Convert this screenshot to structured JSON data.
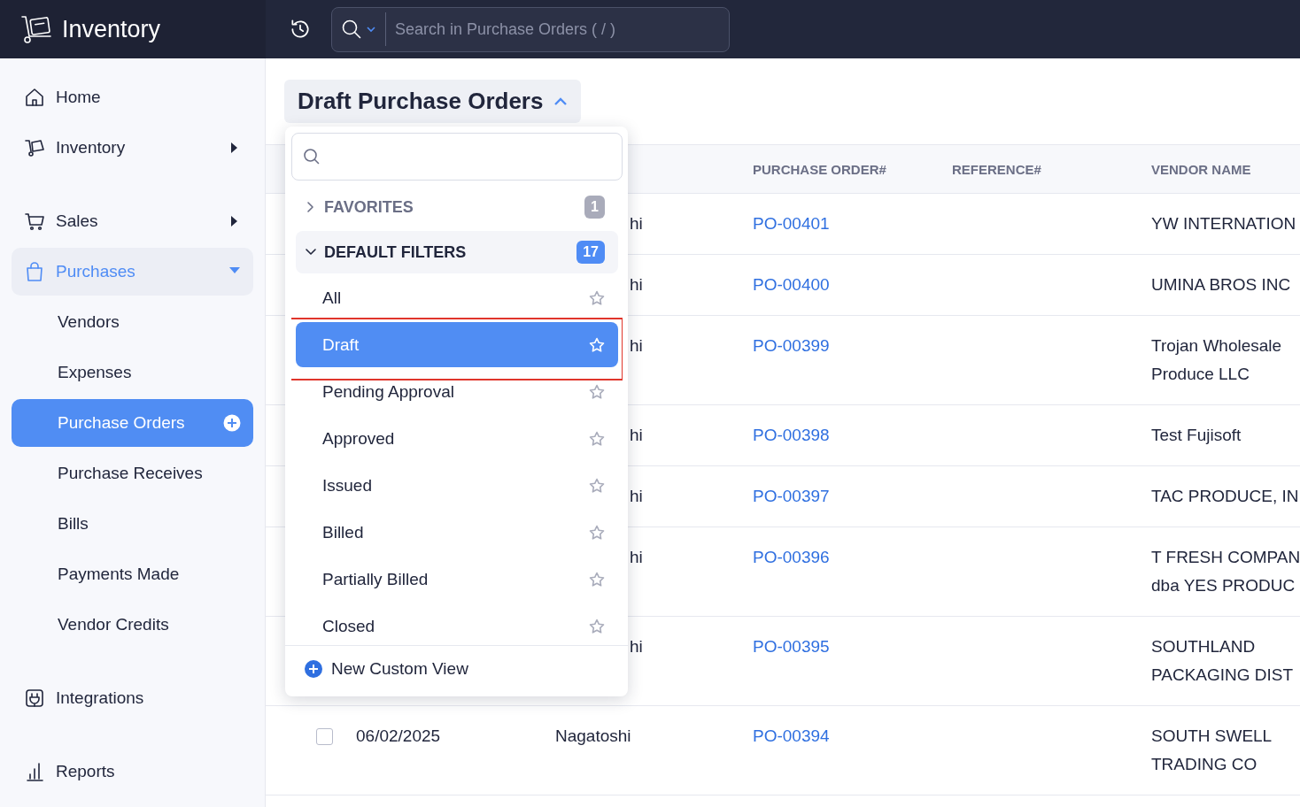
{
  "app": {
    "title": "Inventory"
  },
  "search": {
    "placeholder": "Search in Purchase Orders ( / )"
  },
  "sidebar": {
    "sections": [
      {
        "items": [
          {
            "label": "Home",
            "selected": false
          },
          {
            "label": "Inventory",
            "selected": false,
            "expanded": false
          }
        ]
      },
      {
        "items": [
          {
            "label": "Sales",
            "selected": false,
            "expanded": false
          },
          {
            "label": "Purchases",
            "selected": true,
            "expanded": true,
            "children": [
              {
                "label": "Vendors",
                "selected": false
              },
              {
                "label": "Expenses",
                "selected": false
              },
              {
                "label": "Purchase Orders",
                "selected": true
              },
              {
                "label": "Purchase Receives",
                "selected": false
              },
              {
                "label": "Bills",
                "selected": false
              },
              {
                "label": "Payments Made",
                "selected": false
              },
              {
                "label": "Vendor Credits",
                "selected": false
              }
            ]
          }
        ]
      },
      {
        "items": [
          {
            "label": "Integrations",
            "selected": false
          }
        ]
      },
      {
        "items": [
          {
            "label": "Reports",
            "selected": false
          }
        ]
      }
    ]
  },
  "view": {
    "title": "Draft Purchase Orders",
    "open": true
  },
  "dropdown": {
    "groups": [
      {
        "label": "FAVORITES",
        "count": "1",
        "expanded": false
      },
      {
        "label": "DEFAULT FILTERS",
        "count": "17",
        "expanded": true,
        "items": [
          {
            "label": "All",
            "selected": false,
            "highlighted": false
          },
          {
            "label": "Draft",
            "selected": true,
            "highlighted": true
          },
          {
            "label": "Pending Approval",
            "selected": false,
            "highlighted": false
          },
          {
            "label": "Approved",
            "selected": false,
            "highlighted": false
          },
          {
            "label": "Issued",
            "selected": false,
            "highlighted": false
          },
          {
            "label": "Billed",
            "selected": false,
            "highlighted": false
          },
          {
            "label": "Partially Billed",
            "selected": false,
            "highlighted": false
          },
          {
            "label": "Closed",
            "selected": false,
            "highlighted": false
          }
        ]
      }
    ],
    "footer": {
      "label": "New Custom View"
    }
  },
  "table": {
    "columns": [
      "PURCHASE ORDER#",
      "REFERENCE#",
      "VENDOR NAME"
    ],
    "rows": [
      {
        "column_3": "hi",
        "purchase_order": "PO-00401",
        "vendor_name": [
          "YW INTERNATION"
        ]
      },
      {
        "column_3": "hi",
        "purchase_order": "PO-00400",
        "vendor_name": [
          "UMINA BROS INC"
        ]
      },
      {
        "column_3": "hi",
        "purchase_order": "PO-00399",
        "vendor_name": [
          "Trojan Wholesale",
          "Produce LLC"
        ]
      },
      {
        "column_3": "hi",
        "purchase_order": "PO-00398",
        "vendor_name": [
          "Test Fujisoft"
        ]
      },
      {
        "column_3": "hi",
        "purchase_order": "PO-00397",
        "vendor_name": [
          "TAC PRODUCE, IN"
        ]
      },
      {
        "column_3": "hi",
        "purchase_order": "PO-00396",
        "vendor_name": [
          "T FRESH COMPAN",
          "dba YES PRODUC"
        ]
      },
      {
        "column_3": "hi",
        "purchase_order": "PO-00395",
        "vendor_name": [
          "SOUTHLAND",
          "PACKAGING DIST"
        ]
      },
      {
        "checked": false,
        "column_2": "06/02/2025",
        "column_3": "Nagatoshi",
        "purchase_order": "PO-00394",
        "vendor_name": [
          "SOUTH SWELL",
          "TRADING CO"
        ]
      }
    ]
  }
}
